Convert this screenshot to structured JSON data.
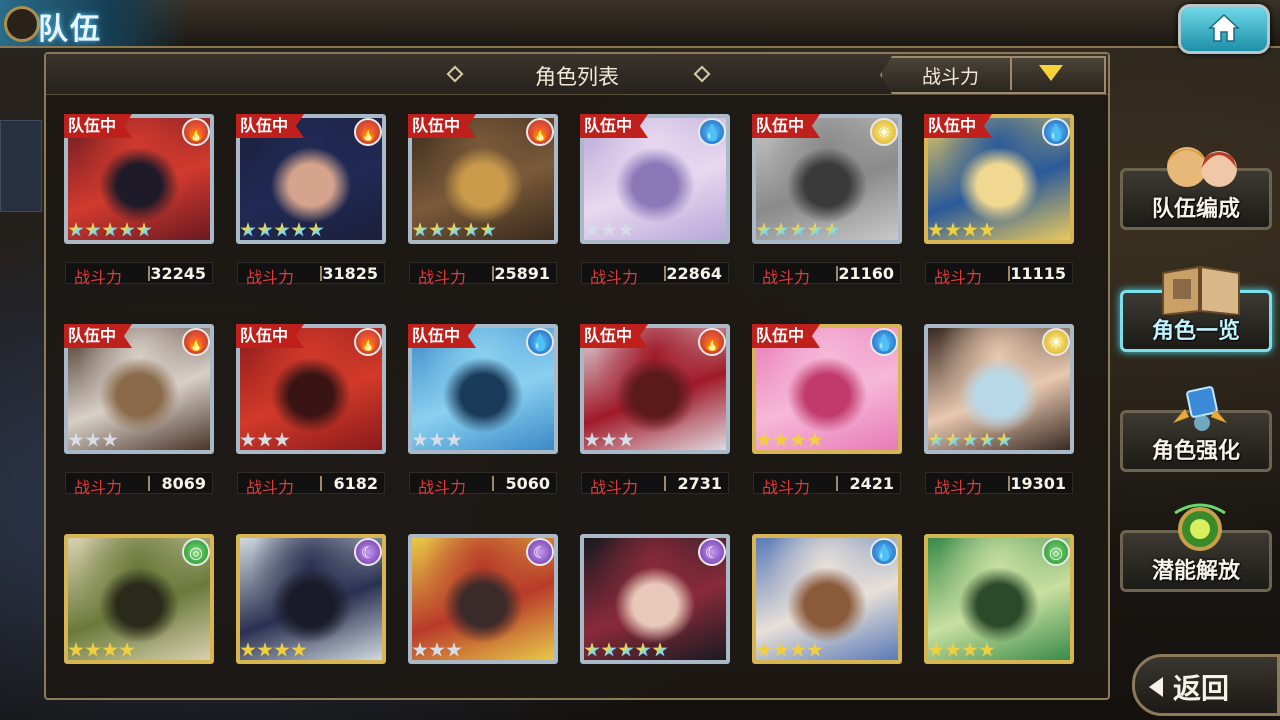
{
  "header": {
    "title": "队伍"
  },
  "panel": {
    "title": "角色列表",
    "sort_label": "战斗力"
  },
  "sidebar": {
    "items": [
      {
        "label": "队伍编成",
        "icon": "team-portrait-icon"
      },
      {
        "label": "角色一览",
        "icon": "book-icon"
      },
      {
        "label": "角色强化",
        "icon": "enhance-crystal-icon"
      },
      {
        "label": "潜能解放",
        "icon": "potential-orb-icon"
      }
    ],
    "active_index": 1
  },
  "back_label": "返回",
  "power_label": "战斗力",
  "in_team_label": "队伍中",
  "characters": [
    {
      "in_team": true,
      "element": "fire",
      "rarity": 5,
      "star_type": "rainbow",
      "frame": "silver",
      "power": "32245",
      "palette": [
        "#6a1a22",
        "#d23a2e",
        "#1f1a28"
      ]
    },
    {
      "in_team": true,
      "element": "fire",
      "rarity": 5,
      "star_type": "rainbow",
      "frame": "silver",
      "power": "31825",
      "palette": [
        "#1c1f3a",
        "#202a55",
        "#d6a48c"
      ]
    },
    {
      "in_team": true,
      "element": "fire",
      "rarity": 5,
      "star_type": "rainbow",
      "frame": "silver",
      "power": "25891",
      "palette": [
        "#3a2a1c",
        "#7a5a3a",
        "#c99a4a"
      ]
    },
    {
      "in_team": true,
      "element": "water",
      "rarity": 3,
      "star_type": "silver",
      "frame": "silver",
      "power": "22864",
      "palette": [
        "#b8a8d8",
        "#e8d8f0",
        "#8a78b8"
      ]
    },
    {
      "in_team": true,
      "element": "light",
      "rarity": 5,
      "star_type": "rainbow",
      "frame": "silver",
      "power": "21160",
      "palette": [
        "#c8c8c8",
        "#8a8a8a",
        "#3a3a3a"
      ]
    },
    {
      "in_team": true,
      "element": "water",
      "rarity": 4,
      "star_type": "gold",
      "frame": "gold",
      "power": "11115",
      "palette": [
        "#e8c860",
        "#2a5a9a",
        "#f0d890"
      ]
    },
    {
      "in_team": true,
      "element": "fire",
      "rarity": 3,
      "star_type": "silver",
      "frame": "silver",
      "power": "8069",
      "palette": [
        "#4a3428",
        "#d8d0c8",
        "#8a6a4a"
      ]
    },
    {
      "in_team": true,
      "element": "fire",
      "rarity": 3,
      "star_type": "silver",
      "frame": "silver",
      "power": "6182",
      "palette": [
        "#8a1a1a",
        "#d23a2a",
        "#3a1414"
      ]
    },
    {
      "in_team": true,
      "element": "water",
      "rarity": 3,
      "star_type": "silver",
      "frame": "silver",
      "power": "5060",
      "palette": [
        "#3a8ac8",
        "#8ad0f0",
        "#1a3a5a"
      ]
    },
    {
      "in_team": true,
      "element": "fire",
      "rarity": 3,
      "star_type": "silver",
      "frame": "silver",
      "power": "2731",
      "palette": [
        "#e0d8e0",
        "#a01a28",
        "#5a1a1a"
      ]
    },
    {
      "in_team": true,
      "element": "water",
      "rarity": 4,
      "star_type": "gold",
      "frame": "gold",
      "power": "2421",
      "palette": [
        "#e87ab8",
        "#f6b8d8",
        "#c03a6a"
      ]
    },
    {
      "in_team": false,
      "element": "light",
      "rarity": 5,
      "star_type": "rainbow",
      "frame": "silver",
      "power": "19301",
      "palette": [
        "#3a2a22",
        "#e8c8b0",
        "#b8d8e8"
      ]
    },
    {
      "in_team": false,
      "element": "wind",
      "rarity": 4,
      "star_type": "gold",
      "frame": "gold",
      "power": "",
      "palette": [
        "#d8d0b0",
        "#6a7a3a",
        "#2a2a1a"
      ]
    },
    {
      "in_team": false,
      "element": "dark",
      "rarity": 4,
      "star_type": "gold",
      "frame": "gold",
      "power": "",
      "palette": [
        "#d0d8e0",
        "#2a3050",
        "#1a1a28"
      ]
    },
    {
      "in_team": false,
      "element": "dark",
      "rarity": 3,
      "star_type": "silver",
      "frame": "silver",
      "power": "",
      "palette": [
        "#e8c848",
        "#b83a2a",
        "#3a2a2a"
      ]
    },
    {
      "in_team": false,
      "element": "dark",
      "rarity": 5,
      "star_type": "rainbow",
      "frame": "silver",
      "power": "",
      "palette": [
        "#1a1a22",
        "#8a2a3a",
        "#e8c8b8"
      ]
    },
    {
      "in_team": false,
      "element": "water",
      "rarity": 4,
      "star_type": "gold",
      "frame": "gold",
      "power": "",
      "palette": [
        "#5a7ab8",
        "#e8e0d8",
        "#8a5a3a"
      ]
    },
    {
      "in_team": false,
      "element": "wind",
      "rarity": 4,
      "star_type": "gold",
      "frame": "gold",
      "power": "",
      "palette": [
        "#3a8a4a",
        "#c8e0a0",
        "#2a4a2a"
      ]
    }
  ],
  "element_icons": {
    "fire": "flame-icon",
    "water": "water-drop-icon",
    "light": "sun-icon",
    "wind": "wind-swirl-icon",
    "dark": "moon-icon"
  }
}
